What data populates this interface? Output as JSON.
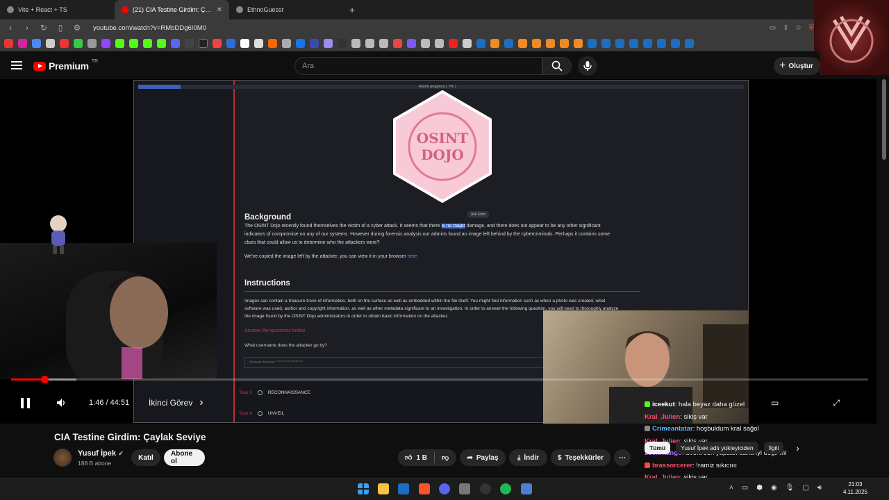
{
  "tabs": [
    {
      "title": "Vite + React + TS"
    },
    {
      "title": "(21) CIA Testine Girdim: Çaylak Seviye"
    },
    {
      "title": "EthnoGuessr"
    }
  ],
  "address": {
    "url": "youtube.com/watch?v=RMbDDg6I0M0"
  },
  "colors": {
    "yt_red": "#ff0000",
    "accent_task": "#c23a4d",
    "bg": "#0f0f0f"
  },
  "header": {
    "brand": "Premium",
    "region": "TR",
    "search_placeholder": "Ara",
    "create_label": "Oluştur"
  },
  "screen": {
    "progress_label": "Room progress ( 7% )",
    "progress_value": 0.07,
    "ask_echo": "Ask Echo",
    "background_heading": "Background",
    "bg_text_1a": "The OSINT Dojo recently found themselves the victim of a cyber attack. It seems that there ",
    "bg_text_1h": "is no major",
    "bg_text_1b": " damage, and there does not appear to be any other significant",
    "bg_text_2": "indicators of compromise on any of our systems. However during forensic analysis our admins found an image left behind by the cybercriminals. Perhaps it contains some",
    "bg_text_3": "clues that could allow us to determine who the attackers were?",
    "bg_text_4a": "We've copied the image left by the attacker, you can view it in your browser ",
    "bg_text_4link": "here",
    "instructions_heading": "Instructions",
    "ins_1": "Images can contain a treasure trove of information, both on the surface as well as embedded within the file itself. You might find information such as when a photo was created, what",
    "ins_2": "software was used, author and copyright information, as well as other metadata significant to an investigation. In order to answer the following question, you will need to thoroughly analyze",
    "ins_3": "the image found by the OSINT Dojo administrators in order to obtain basic information on the attacker.",
    "answer_link": "Answer the questions below",
    "question": "What username does the attacker go by?",
    "answer_placeholder": "Answer format: ******************",
    "tasks": [
      {
        "num": "Task 3",
        "name": "RECONNAISSANCE"
      },
      {
        "num": "Task 4",
        "name": "UNVEIL"
      }
    ],
    "logo_line1": "OSINT",
    "logo_line2": "DOJO"
  },
  "player": {
    "time": "1:46 / 44:51",
    "chapter": "İkinci Görev",
    "played_fraction": 0.039
  },
  "chat": [
    {
      "user": "iceekut",
      "msg": ": hala beyaz daha güzel",
      "badge_color": "#53fc18"
    },
    {
      "user": "Kral_Julien",
      "msg": ": sikiş var",
      "badge_color": "#ff4444"
    },
    {
      "user": "Crimeantatar",
      "msg": ": hoşbuldum kral sağol",
      "badge_color": "#888888"
    },
    {
      "user": "Kral_Julien",
      "msg": ": sikiş var",
      "badge_color": "#ff4444"
    },
    {
      "user": "zoonhtango",
      "msg": ": direkt sen yapsan daha iyi değil mi",
      "badge_color": "#888888"
    },
    {
      "user": "brassorcerer",
      "msg": ": !ramiz sıkıcıııı",
      "badge_color": "#ff4444"
    },
    {
      "user": "Kral_Julien",
      "msg": ": sikiş var",
      "badge_color": "#ff4444"
    }
  ],
  "video_info": {
    "title": "CIA Testine Girdim: Çaylak Seviye",
    "channel": "Yusuf İpek",
    "subscribers": "188 B abone",
    "join": "Katıl",
    "subscribe": "Abone ol",
    "likes": "1 B",
    "share": "Paylaş",
    "download": "İndir",
    "thanks": "Teşekkürler"
  },
  "suggestions": {
    "tabs": [
      "Tümü",
      "Yusuf İpek adlı yükleyiciden",
      "İlgili"
    ]
  },
  "clock": {
    "time": "21:03",
    "date": "4.11.2025"
  }
}
